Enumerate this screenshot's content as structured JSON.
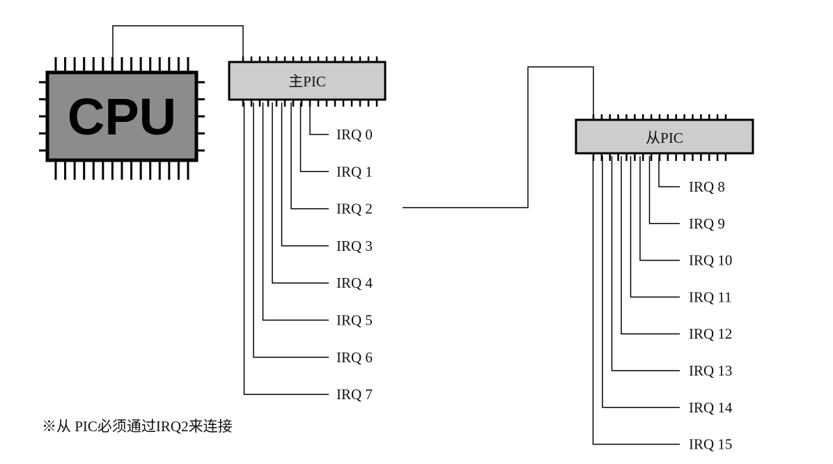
{
  "cpu": {
    "label": "CPU"
  },
  "master_pic": {
    "label": "主PIC",
    "irqs": [
      "IRQ 0",
      "IRQ 1",
      "IRQ 2",
      "IRQ 3",
      "IRQ 4",
      "IRQ 5",
      "IRQ 6",
      "IRQ 7"
    ]
  },
  "slave_pic": {
    "label": "从PIC",
    "irqs": [
      "IRQ 8",
      "IRQ 9",
      "IRQ 10",
      "IRQ 11",
      "IRQ 12",
      "IRQ 13",
      "IRQ 14",
      "IRQ 15"
    ]
  },
  "note": "※从 PIC必须通过IRQ2来连接",
  "colors": {
    "cpu_body": "#8c8c8c",
    "pic_body": "#cdcdcd",
    "line": "#000000"
  }
}
